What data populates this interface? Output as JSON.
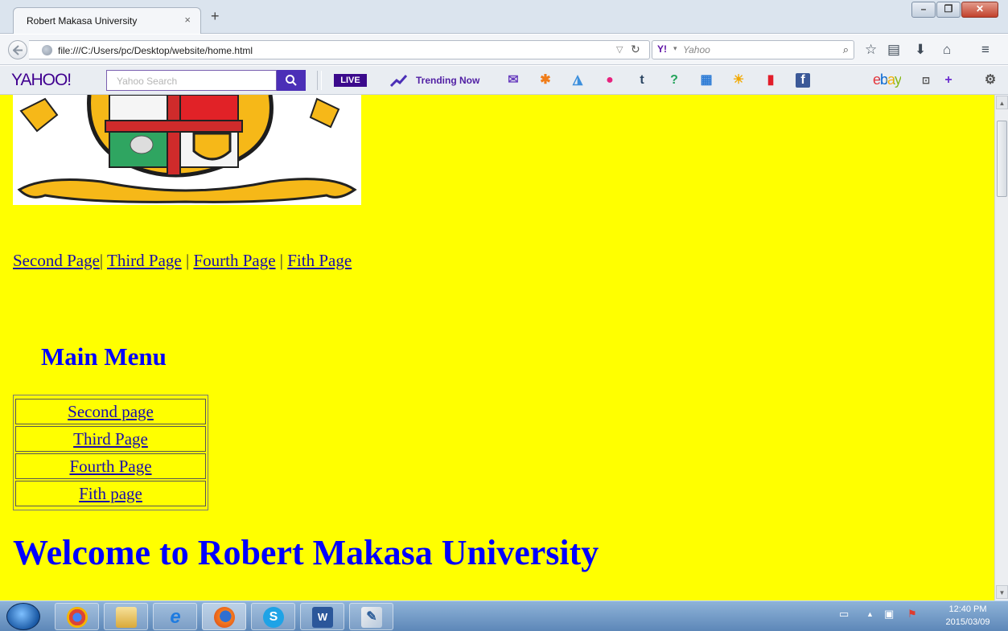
{
  "browser": {
    "tab_title": "Robert Makasa University",
    "tab_close": "×",
    "new_tab": "+",
    "url": "file:///C:/Users/pc/Desktop/website/home.html",
    "search_engine_placeholder": "Yahoo"
  },
  "yahoo_toolbar": {
    "logo": "YAHOO!",
    "search_placeholder": "Yahoo Search",
    "live_label": "LIVE",
    "trending_label": "Trending Now",
    "ebay_label": "ebay"
  },
  "page": {
    "top_links": [
      "Second Page",
      "Third Page",
      "Fourth Page",
      "Fith Page"
    ],
    "separator": "|",
    "menu_title": "Main Menu",
    "menu_items": [
      "Second page",
      "Third Page",
      "Fourth Page",
      "Fith page"
    ],
    "welcome": "Welcome to Robert Makasa University"
  },
  "taskbar": {
    "time": "12:40 PM",
    "date": "2015/03/09"
  },
  "colors": {
    "page_background": "#ffff00",
    "heading_blue": "#0000ff",
    "link_blue": "#1a0dab",
    "yahoo_purple": "#400090"
  }
}
